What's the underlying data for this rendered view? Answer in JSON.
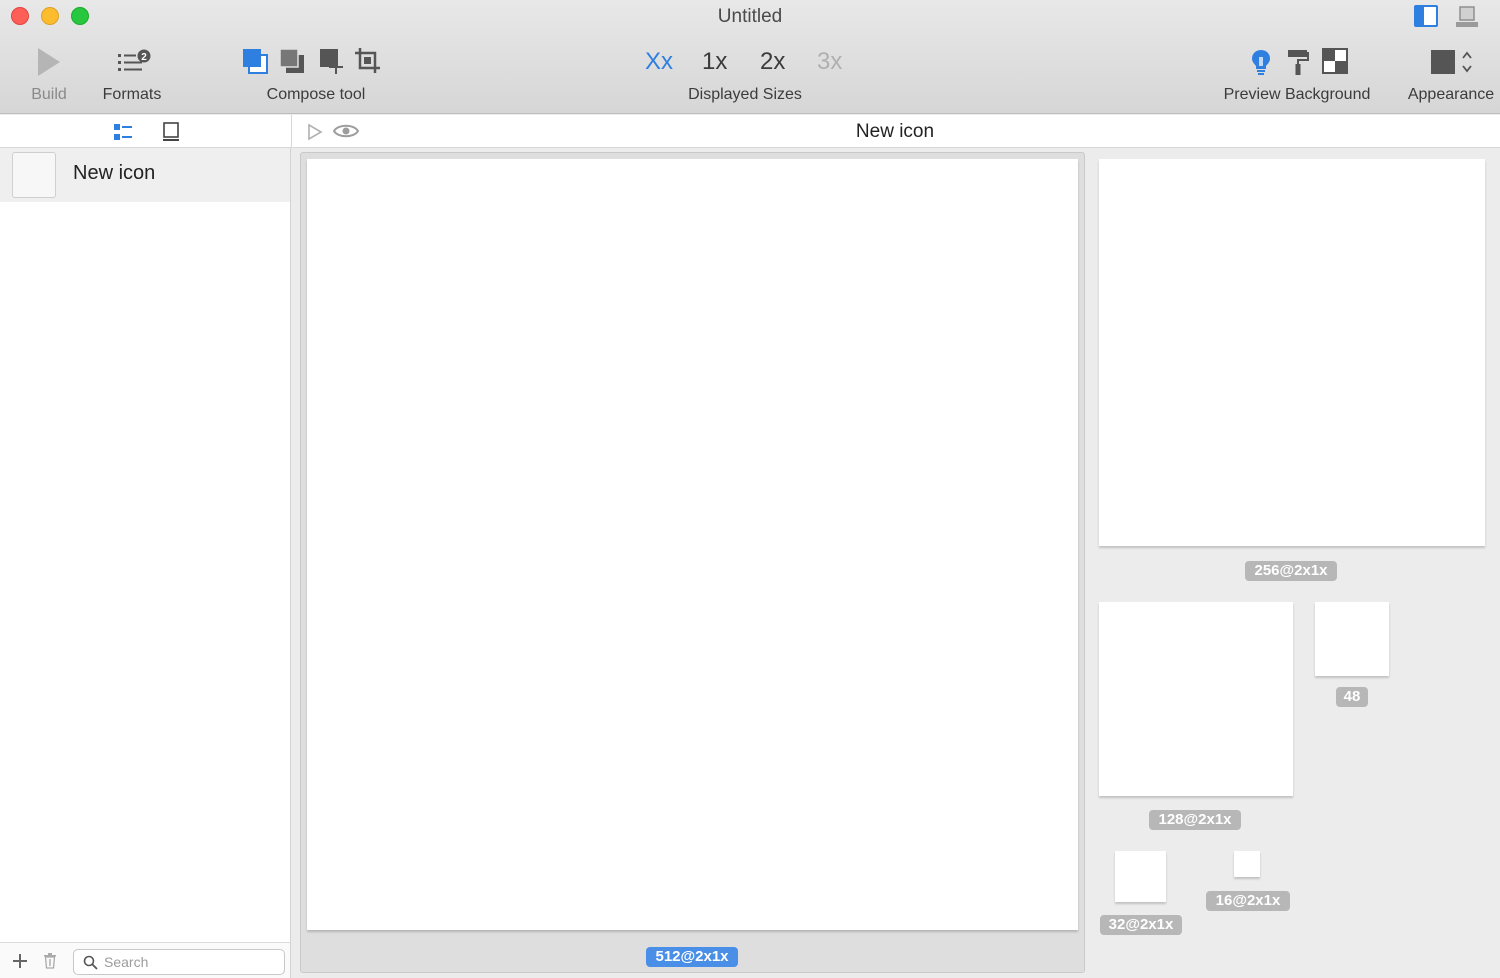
{
  "window": {
    "title": "Untitled"
  },
  "toolbar": {
    "build": {
      "label": "Build",
      "icon": "play-icon"
    },
    "formats": {
      "label": "Formats",
      "badge": "2",
      "icon": "list-icon"
    },
    "compose": {
      "label": "Compose tool"
    },
    "sizes": {
      "label": "Displayed Sizes",
      "options": [
        "Xx",
        "1x",
        "2x",
        "3x"
      ],
      "active": "Xx",
      "disabled": "3x"
    },
    "preview": {
      "label": "Preview Background"
    },
    "appearance": {
      "label": "Appearance"
    }
  },
  "subbar": {
    "document_title": "New icon"
  },
  "sidebar": {
    "items": [
      {
        "name": "New icon"
      }
    ],
    "search": {
      "placeholder": "Search",
      "value": ""
    }
  },
  "canvas": {
    "tiles": [
      {
        "label": "512@2x1x",
        "selected": true
      },
      {
        "label": "256@2x1x",
        "selected": false
      },
      {
        "label": "128@2x1x",
        "selected": false
      },
      {
        "label": "48",
        "selected": false
      },
      {
        "label": "32@2x1x",
        "selected": false
      },
      {
        "label": "16@2x1x",
        "selected": false
      }
    ]
  },
  "colors": {
    "accent": "#2f7fe0",
    "badge": "#b7b7b7",
    "badge_selected": "#4a8fe7"
  }
}
